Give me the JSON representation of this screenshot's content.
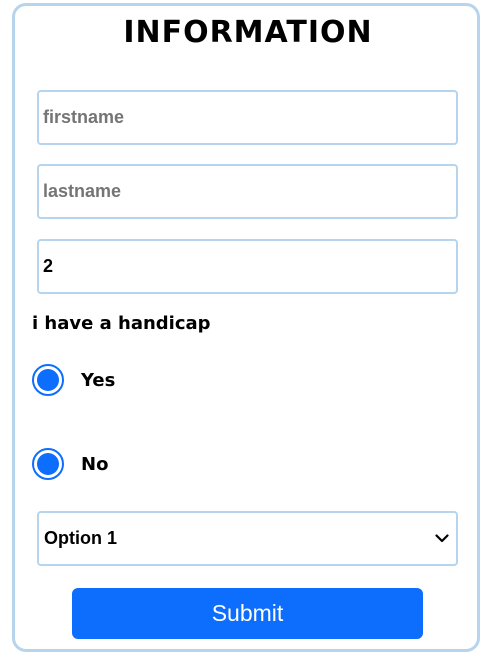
{
  "form": {
    "title": "INFORMATION",
    "firstname": {
      "placeholder": "firstname",
      "value": ""
    },
    "lastname": {
      "placeholder": "lastname",
      "value": ""
    },
    "number": {
      "value": "2"
    },
    "handicap_question": "i have a handicap",
    "radio_options": [
      {
        "label": "Yes",
        "checked": true
      },
      {
        "label": "No",
        "checked": true
      }
    ],
    "select": {
      "selected": "Option 1",
      "icon": "chevron-down-icon"
    },
    "submit_label": "Submit",
    "colors": {
      "accent": "#0d6efd",
      "border": "#b7d4ee",
      "placeholder": "#757575"
    }
  }
}
